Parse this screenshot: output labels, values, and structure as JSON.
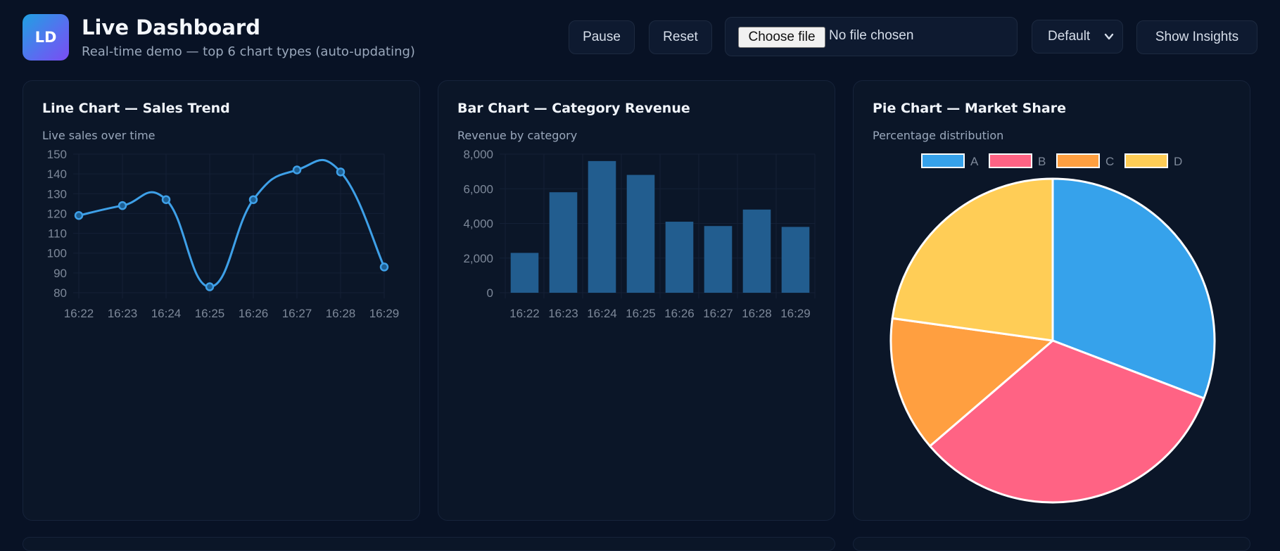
{
  "header": {
    "logo_text": "LD",
    "title": "Live Dashboard",
    "subtitle": "Real-time demo — top 6 chart types (auto-updating)",
    "buttons": {
      "pause": "Pause",
      "reset": "Reset",
      "insights": "Show Insights"
    },
    "file_input": {
      "button_label": "Choose file",
      "status": "No file chosen"
    },
    "theme_select": {
      "selected": "Default"
    }
  },
  "colors": {
    "background": "#081225",
    "card": "#0b1628",
    "line": "#3ea0e8",
    "bar": "#225d8f",
    "pie_a": "#36a2eb",
    "pie_b": "#ff6384",
    "pie_c": "#ff9f40",
    "pie_d": "#ffcd56"
  },
  "cards": {
    "line": {
      "title": "Line Chart — Sales Trend",
      "subtitle": "Live sales over time"
    },
    "bar": {
      "title": "Bar Chart — Category Revenue",
      "subtitle": "Revenue by category"
    },
    "pie": {
      "title": "Pie Chart — Market Share",
      "subtitle": "Percentage distribution"
    }
  },
  "chart_data": [
    {
      "type": "line",
      "title": "Line Chart — Sales Trend",
      "subtitle": "Live sales over time",
      "categories": [
        "16:22",
        "16:23",
        "16:24",
        "16:25",
        "16:26",
        "16:27",
        "16:28",
        "16:29"
      ],
      "values": [
        119,
        124,
        127,
        83,
        127,
        142,
        141,
        93
      ],
      "ylim": [
        80,
        150
      ],
      "yticks": [
        "150",
        "140",
        "130",
        "120",
        "110",
        "100",
        "90",
        "80"
      ],
      "grid": true,
      "smooth": true
    },
    {
      "type": "bar",
      "title": "Bar Chart — Category Revenue",
      "subtitle": "Revenue by category",
      "categories": [
        "16:22",
        "16:23",
        "16:24",
        "16:25",
        "16:26",
        "16:27",
        "16:28",
        "16:29"
      ],
      "values": [
        2300,
        5800,
        7600,
        6800,
        4100,
        3850,
        4800,
        3800
      ],
      "ylim": [
        0,
        8000
      ],
      "yticks": [
        "8,000",
        "6,000",
        "4,000",
        "2,000",
        "0"
      ],
      "grid": true
    },
    {
      "type": "pie",
      "title": "Pie Chart — Market Share",
      "subtitle": "Percentage distribution",
      "categories": [
        "A",
        "B",
        "C",
        "D"
      ],
      "values": [
        30.8,
        32.9,
        13.5,
        22.8
      ],
      "legend": "top"
    }
  ]
}
